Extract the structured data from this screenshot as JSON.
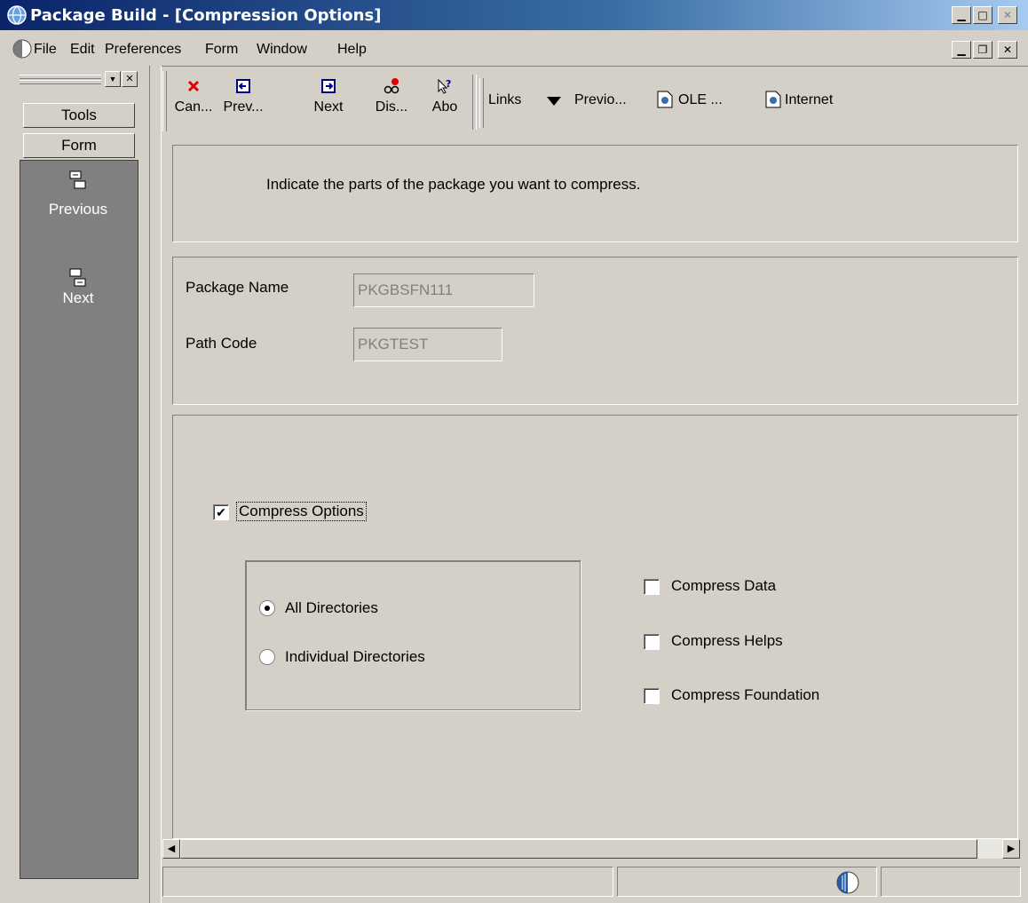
{
  "window": {
    "title": "Package Build - [Compression Options]"
  },
  "menu": [
    "File",
    "Edit",
    "Preferences",
    "Form",
    "Window",
    "Help"
  ],
  "left_pane": {
    "tools_label": "Tools",
    "form_label": "Form",
    "previous_label": "Previous",
    "next_label": "Next"
  },
  "toolbar": {
    "cancel_label": "Can...",
    "prev_label": "Prev...",
    "next_label": "Next",
    "display_label": "Dis...",
    "about_label": "Abo",
    "links_label": "Links",
    "previous_link_label": "Previo...",
    "ole_label": "OLE ...",
    "internet_label": "Internet"
  },
  "instructions": "Indicate the parts of the package you want to compress.",
  "header": {
    "package_name_label": "Package Name",
    "package_name_value": "PKGBSFN111",
    "path_code_label": "Path Code",
    "path_code_value": "PKGTEST"
  },
  "options": {
    "compress_options_label": "Compress Options",
    "compress_options_checked": true,
    "all_directories_label": "All Directories",
    "individual_directories_label": "Individual Directories",
    "selected_directory_option": "All Directories",
    "compress_data_label": "Compress Data",
    "compress_helps_label": "Compress Helps",
    "compress_foundation_label": "Compress Foundation"
  },
  "colors": {
    "title_bar": "#0a246a",
    "face": "#d4d0c8",
    "left_pane_dark": "#808080"
  }
}
